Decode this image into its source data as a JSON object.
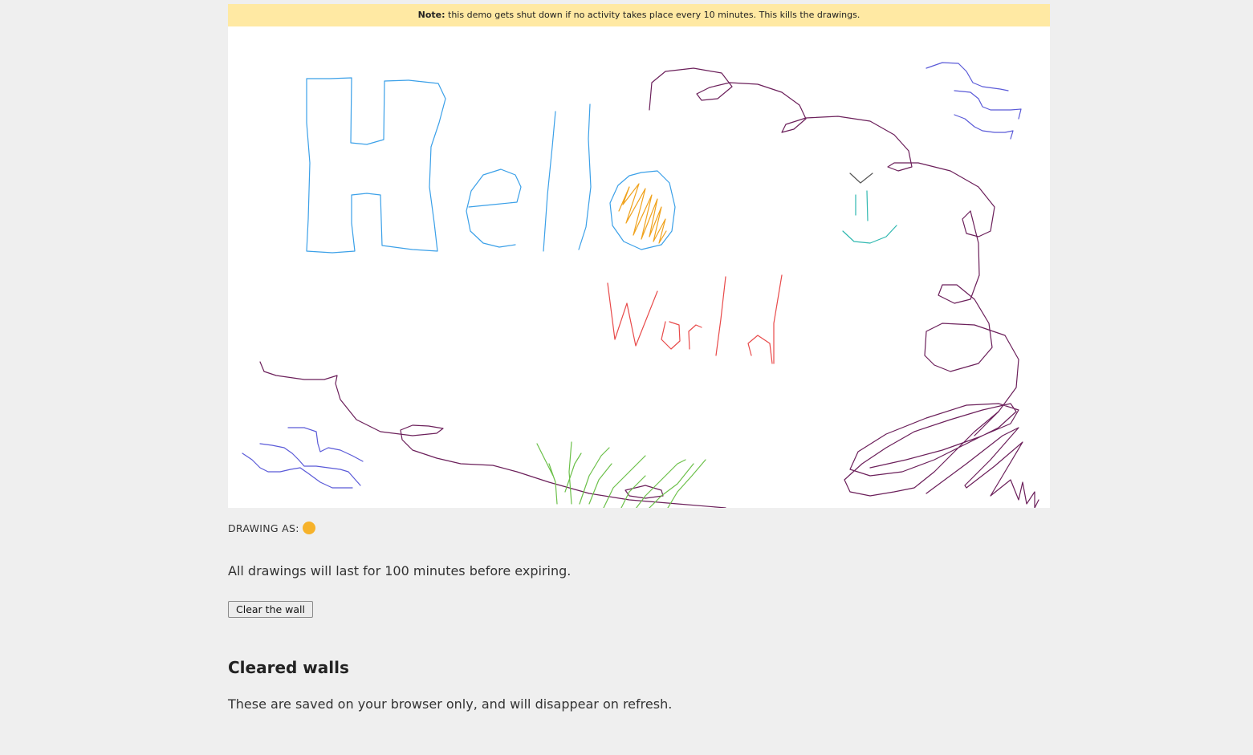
{
  "note": {
    "label": "Note:",
    "text": " this demo gets shut down if no activity takes place every 10 minutes. This kills the drawings."
  },
  "drawing_as": {
    "label": "DRAWING AS:",
    "color": "#f6b22a"
  },
  "expiry_text": "All drawings will last for 100 minutes before expiring.",
  "clear_button_label": "Clear the wall",
  "cleared_walls": {
    "heading": "Cleared walls",
    "description": "These are saved on your browser only, and will disappear on refresh."
  },
  "stroke_colors": {
    "blue": "#3ba0e8",
    "orange": "#f0a21c",
    "teal": "#2fb8b0",
    "red": "#e84a4a",
    "purple": "#6b1f5a",
    "indigo": "#5a5ad8",
    "green": "#6cc04a"
  }
}
